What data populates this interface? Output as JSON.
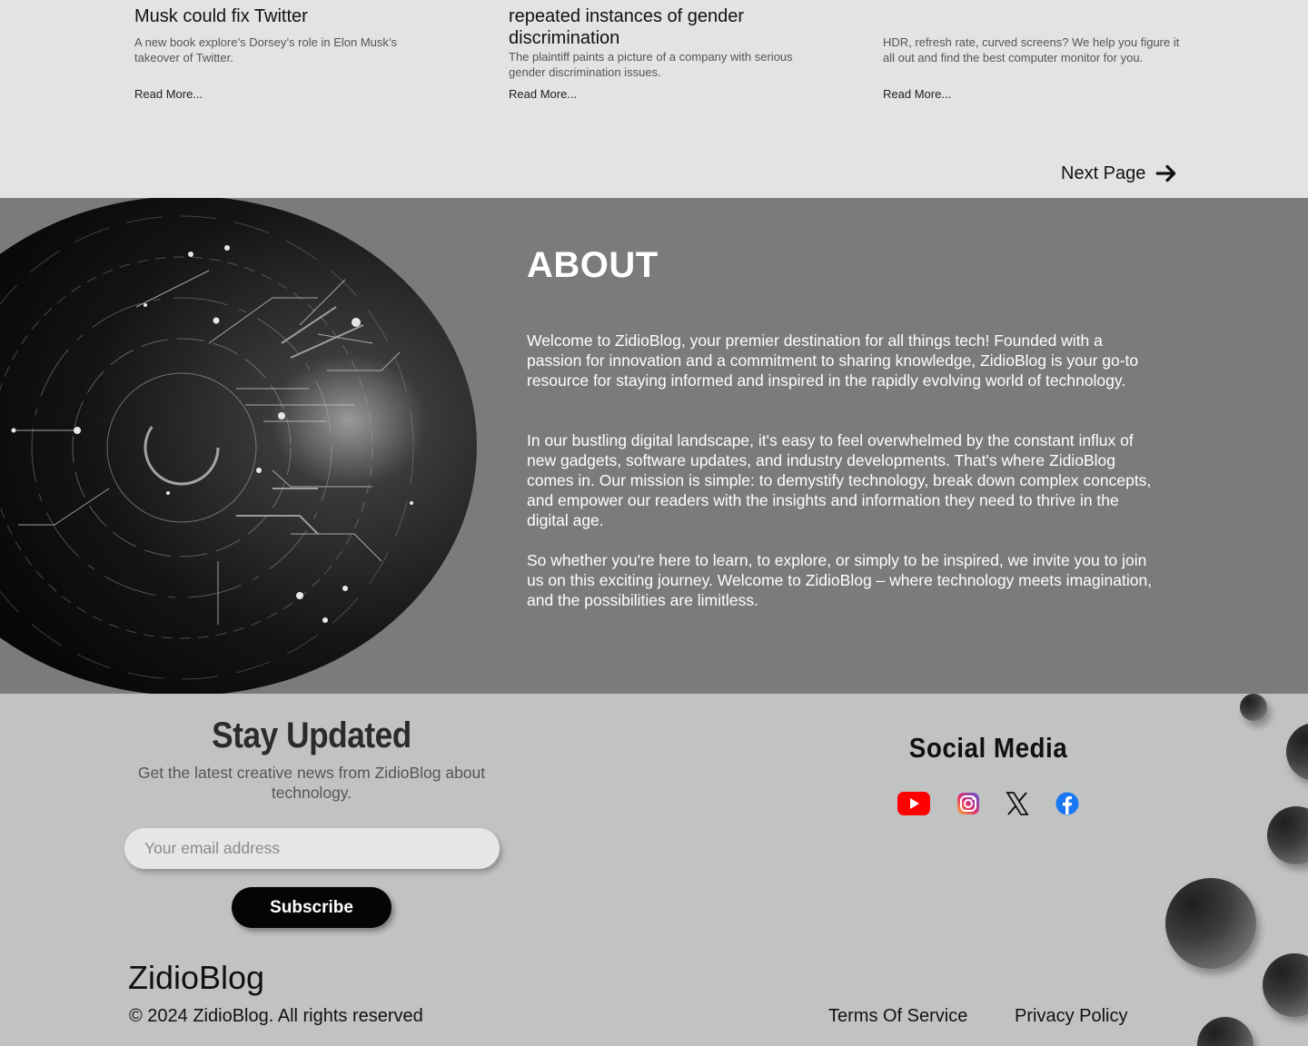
{
  "articles": [
    {
      "title": "Musk could fix Twitter",
      "desc": "A new book explore’s Dorsey’s role in Elon Musk’s takeover of Twitter.",
      "read_more": "Read More..."
    },
    {
      "title_line1": "repeated instances of gender",
      "title_line2": "discrimination",
      "desc": "The plaintiff paints a picture of a company with serious gender discrimination issues.",
      "read_more": "Read More..."
    },
    {
      "desc": "HDR, refresh rate, curved screens? We help you figure it all out and find the best computer monitor for you.",
      "read_more": "Read More..."
    }
  ],
  "pagination": {
    "next_label": "Next Page",
    "icon": "arrow-right-icon"
  },
  "about": {
    "title": "ABOUT",
    "paragraphs": [
      "Welcome to ZidioBlog, your premier destination for all things tech! Founded with a passion for innovation and a commitment to sharing knowledge, ZidioBlog is your go-to resource for staying informed and inspired in the rapidly evolving world of technology.",
      "In our bustling digital landscape, it's easy to feel overwhelmed by the constant influx of new gadgets, software updates, and industry developments. That's where ZidioBlog comes in. Our mission is simple: to demystify technology, break down complex concepts, and empower our readers with the insights and information they need to thrive in the digital age.",
      "So whether you're here to learn, to explore, or simply to be inspired, we invite you to join us on this exciting journey. Welcome to ZidioBlog – where technology meets imagination, and the possibilities are limitless."
    ]
  },
  "newsletter": {
    "title": "Stay Updated",
    "subtitle": "Get the latest creative news from ZidioBlog about technology.",
    "email_placeholder": "Your email address",
    "subscribe_label": "Subscribe"
  },
  "social": {
    "title": "Social Media",
    "icons": [
      "youtube-icon",
      "instagram-icon",
      "x-icon",
      "facebook-icon"
    ]
  },
  "footer": {
    "brand": "ZidioBlog",
    "copyright": "© 2024 ZidioBlog. All rights reserved",
    "terms_label": "Terms Of Service",
    "privacy_label": "Privacy Policy"
  },
  "colors": {
    "about_bg": "#7b7b7b",
    "footer_bg": "#c1c3c3",
    "page_bg": "#e2e3e3",
    "button_bg": "#050505"
  }
}
